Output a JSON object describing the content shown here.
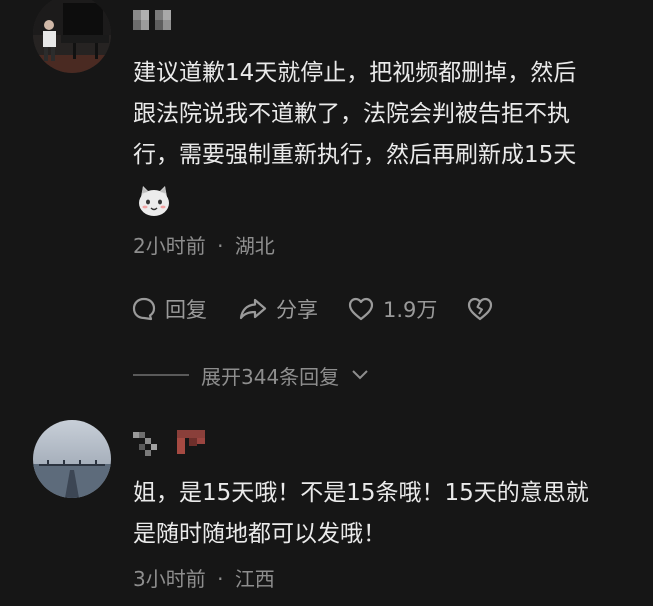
{
  "comments": [
    {
      "text": "建议道歉14天就停止，把视频都删掉，然后\n跟法院说我不道歉了，法院会判被告拒不执\n行，需要强制重新执行，然后再刷新成15天",
      "emoji_icon": "cat-face-emoji-icon",
      "time": "2小时前",
      "location": "湖北",
      "reply_label": "回复",
      "share_label": "分享",
      "likes": "1.9万",
      "expand_label": "展开344条回复"
    },
    {
      "text": "姐，是15天哦！不是15条哦！15天的意思就\n是随时随地都可以发哦！",
      "time": "3小时前",
      "location": "江西"
    }
  ],
  "separator": "·",
  "colors": {
    "background": "#161616",
    "text": "#eaeaea",
    "meta": "#8e8e8e"
  }
}
